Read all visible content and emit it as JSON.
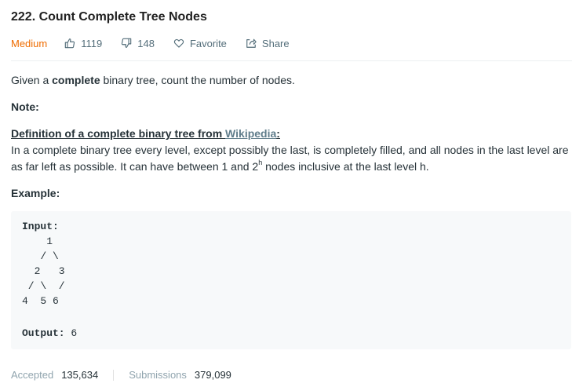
{
  "problem": {
    "title": "222. Count Complete Tree Nodes",
    "difficulty": "Medium",
    "likes": "1119",
    "dislikes": "148",
    "favorite_label": "Favorite",
    "share_label": "Share"
  },
  "description": {
    "intro_pre": "Given a ",
    "intro_bold": "complete",
    "intro_post": " binary tree, count the number of nodes.",
    "note_label": "Note:",
    "definition_heading": "Definition of a complete binary tree from ",
    "definition_link": "Wikipedia",
    "definition_colon": ":",
    "definition_text_1": "In a complete binary tree every level, except possibly the last, is completely filled, and all nodes in the last level are as far left as possible. It can have between 1 and 2",
    "definition_sup": "h",
    "definition_text_2": " nodes inclusive at the last level h.",
    "example_label": "Example:"
  },
  "example": {
    "input_label": "Input:",
    "tree_lines": [
      "    1",
      "   / \\",
      "  2   3",
      " / \\  /",
      "4  5 6"
    ],
    "output_label": "Output:",
    "output_value": " 6"
  },
  "stats": {
    "accepted_label": "Accepted",
    "accepted_value": "135,634",
    "submissions_label": "Submissions",
    "submissions_value": "379,099"
  },
  "colors": {
    "difficulty_medium": "#ef6c00",
    "link": "#607d8b",
    "code_bg": "#f7f9fa"
  },
  "icons": [
    "thumbs-up-icon",
    "thumbs-down-icon",
    "heart-icon",
    "share-icon"
  ]
}
